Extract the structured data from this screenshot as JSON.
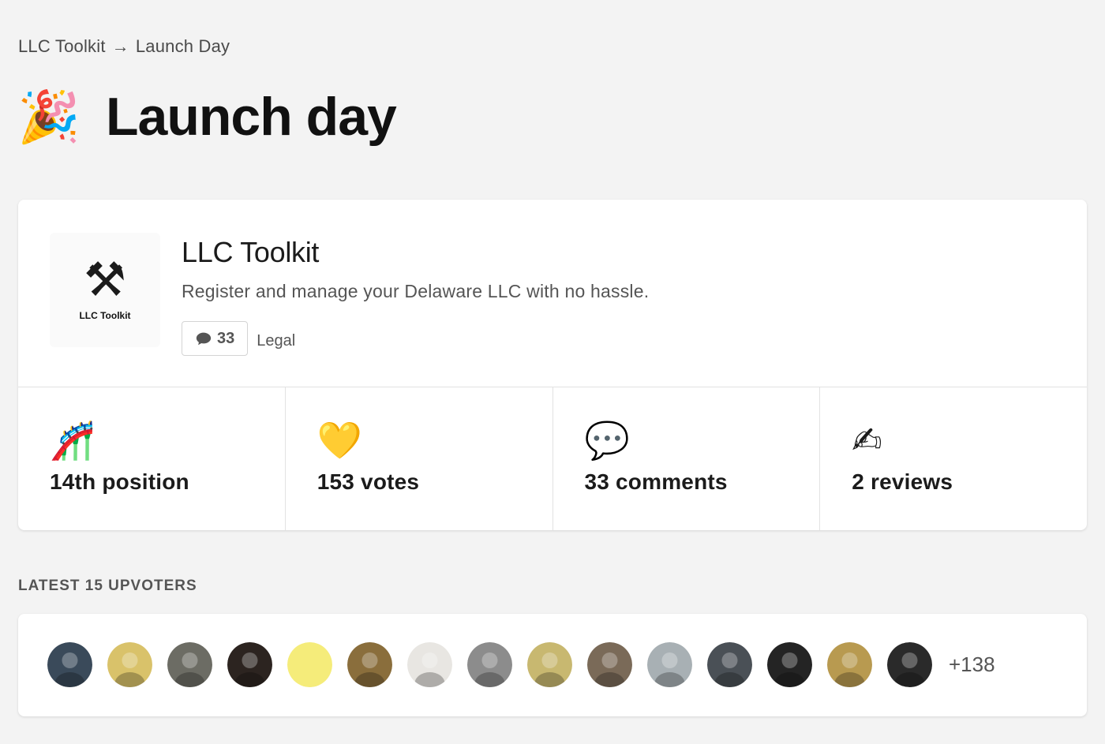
{
  "breadcrumb": {
    "product": "LLC Toolkit",
    "arrow": "→",
    "current": "Launch Day"
  },
  "page": {
    "emoji": "🎉",
    "title": "Launch day"
  },
  "product": {
    "logo_icon": "⚒",
    "logo_text": "LLC Toolkit",
    "logo_subtext": "",
    "name": "LLC Toolkit",
    "tagline": "Register and manage your Delaware LLC with no hassle.",
    "comment_count": "33",
    "topic": "Legal"
  },
  "stats": [
    {
      "icon": "🎢",
      "icon_name": "roller-coaster-icon",
      "label": "14th position"
    },
    {
      "icon": "💛",
      "icon_name": "gold-heart-icon",
      "label": "153 votes"
    },
    {
      "icon": "💬",
      "icon_name": "speech-bubble-icon",
      "label": "33 comments"
    },
    {
      "icon": "✍",
      "icon_name": "writing-hand-icon",
      "label": "2 reviews"
    }
  ],
  "upvoters": {
    "heading": "LATEST 15 UPVOTERS",
    "more_label": "+138",
    "avatar_colors": [
      "#3a4a5a",
      "#d9c26a",
      "#6c6c64",
      "#2c2420",
      "#f5ec7a",
      "#8a6e3c",
      "#e8e6e2",
      "#8c8c8c",
      "#c8b870",
      "#7a6a58",
      "#a8b0b4",
      "#4a5056",
      "#242424",
      "#b89a50",
      "#2a2a2a"
    ]
  },
  "colors": {
    "background": "#f3f3f3",
    "card": "#ffffff",
    "text_primary": "#1b1b1b",
    "text_secondary": "#555555"
  }
}
